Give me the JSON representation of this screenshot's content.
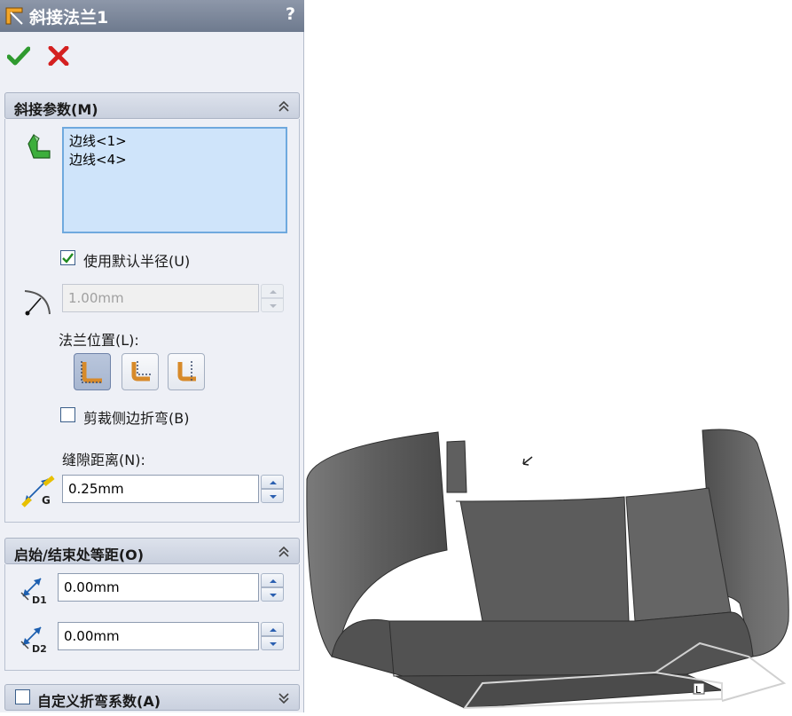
{
  "title": "斜接法兰1",
  "help_label": "?",
  "icons": {
    "title": "miter-flange-icon",
    "ok": "checkmark-icon",
    "cancel": "x-cancel-icon",
    "help": "help-icon"
  },
  "colors": {
    "title_bar": "#7d889b",
    "ok": "#2f9a2f",
    "cancel": "#d42020",
    "selection_box": "#cfe4fa",
    "model": "#5b5b5b"
  },
  "miter_params": {
    "header": "斜接参数(M)",
    "edges": [
      "边线<1>",
      "边线<4>"
    ],
    "use_default_radius_label": "使用默认半径(U)",
    "use_default_radius_checked": true,
    "radius_value": "1.00mm",
    "flange_position_label": "法兰位置(L):",
    "flange_position_options": [
      "material-inside-icon",
      "material-outside-icon",
      "bend-outside-icon"
    ],
    "flange_position_selected": 0,
    "trim_side_bends_label": "剪裁侧边折弯(B)",
    "trim_side_bends_checked": false,
    "gap_distance_label": "缝隙距离(N):",
    "gap_value": "0.25mm",
    "gap_icon_letter": "G"
  },
  "offset": {
    "header": "启始/结束处等距(O)",
    "d1_value": "0.00mm",
    "d1_letter": "D1",
    "d2_value": "0.00mm",
    "d2_letter": "D2"
  },
  "custom_bend": {
    "header": "自定义折弯系数(A)",
    "checked": false
  },
  "model_label_letter": "L"
}
